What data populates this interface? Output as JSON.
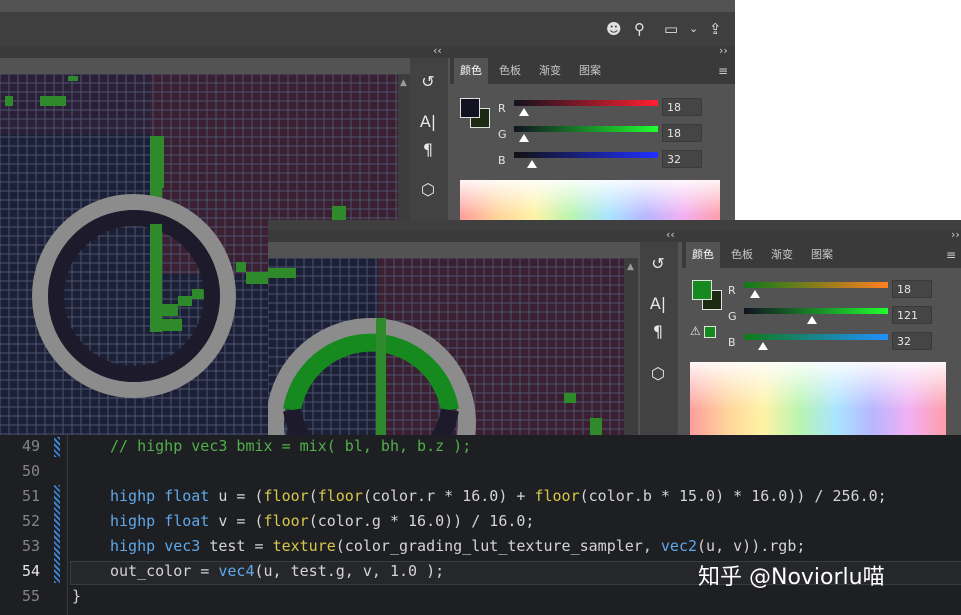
{
  "colors": {
    "accent_green": "#178a1f",
    "ring_gray": "#8c8c8c",
    "ring_dark": "#1c1a2b"
  },
  "back_window": {
    "toolbar_icons": [
      "user-add-icon",
      "search-icon",
      "workspace-icon",
      "chevron-down-icon",
      "share-icon"
    ],
    "collapse_left": "‹‹",
    "collapse_right": "››",
    "tools": [
      {
        "name": "history-tool",
        "glyph": "↺"
      },
      {
        "name": "character-tool",
        "glyph": "A|"
      },
      {
        "name": "paragraph-tool",
        "glyph": "¶"
      },
      {
        "name": "3d-tool",
        "glyph": "⬡"
      }
    ],
    "panel": {
      "tabs": [
        "颜色",
        "色板",
        "渐变",
        "图案"
      ],
      "menu": "≡",
      "sliders": [
        {
          "label": "R",
          "value": "18",
          "fraction": 0.07
        },
        {
          "label": "G",
          "value": "18",
          "fraction": 0.07
        },
        {
          "label": "B",
          "value": "32",
          "fraction": 0.13
        }
      ]
    }
  },
  "front_window": {
    "collapse_left": "‹‹",
    "collapse_right": "››",
    "tools": [
      {
        "name": "history-tool",
        "glyph": "↺"
      },
      {
        "name": "character-tool",
        "glyph": "A|"
      },
      {
        "name": "paragraph-tool",
        "glyph": "¶"
      },
      {
        "name": "3d-tool",
        "glyph": "⬡"
      }
    ],
    "warning": "⚠",
    "panel": {
      "tabs": [
        "颜色",
        "色板",
        "渐变",
        "图案"
      ],
      "menu": "≡",
      "sliders": [
        {
          "label": "R",
          "value": "18",
          "fraction": 0.07
        },
        {
          "label": "G",
          "value": "121",
          "fraction": 0.47
        },
        {
          "label": "B",
          "value": "32",
          "fraction": 0.13
        }
      ]
    }
  },
  "code": {
    "lines": [
      {
        "num": "49",
        "text": "// highp vec3 bmix = mix( bl, bh, b.z );"
      },
      {
        "num": "50",
        "text": ""
      },
      {
        "num": "51",
        "text": "highp float u = (floor(floor(color.r * 16.0) + floor(color.b * 15.0) * 16.0)) / 256.0;"
      },
      {
        "num": "52",
        "text": "highp float v = (floor(color.g * 16.0)) / 16.0;"
      },
      {
        "num": "53",
        "text": "highp vec3 test = texture(color_grading_lut_texture_sampler, vec2(u, v)).rgb;"
      },
      {
        "num": "54",
        "text": "out_color = vec4(u, test.g, v, 1.0 );"
      },
      {
        "num": "55",
        "text": "}"
      }
    ],
    "watermark": "知乎 @Noviorlu喵"
  }
}
